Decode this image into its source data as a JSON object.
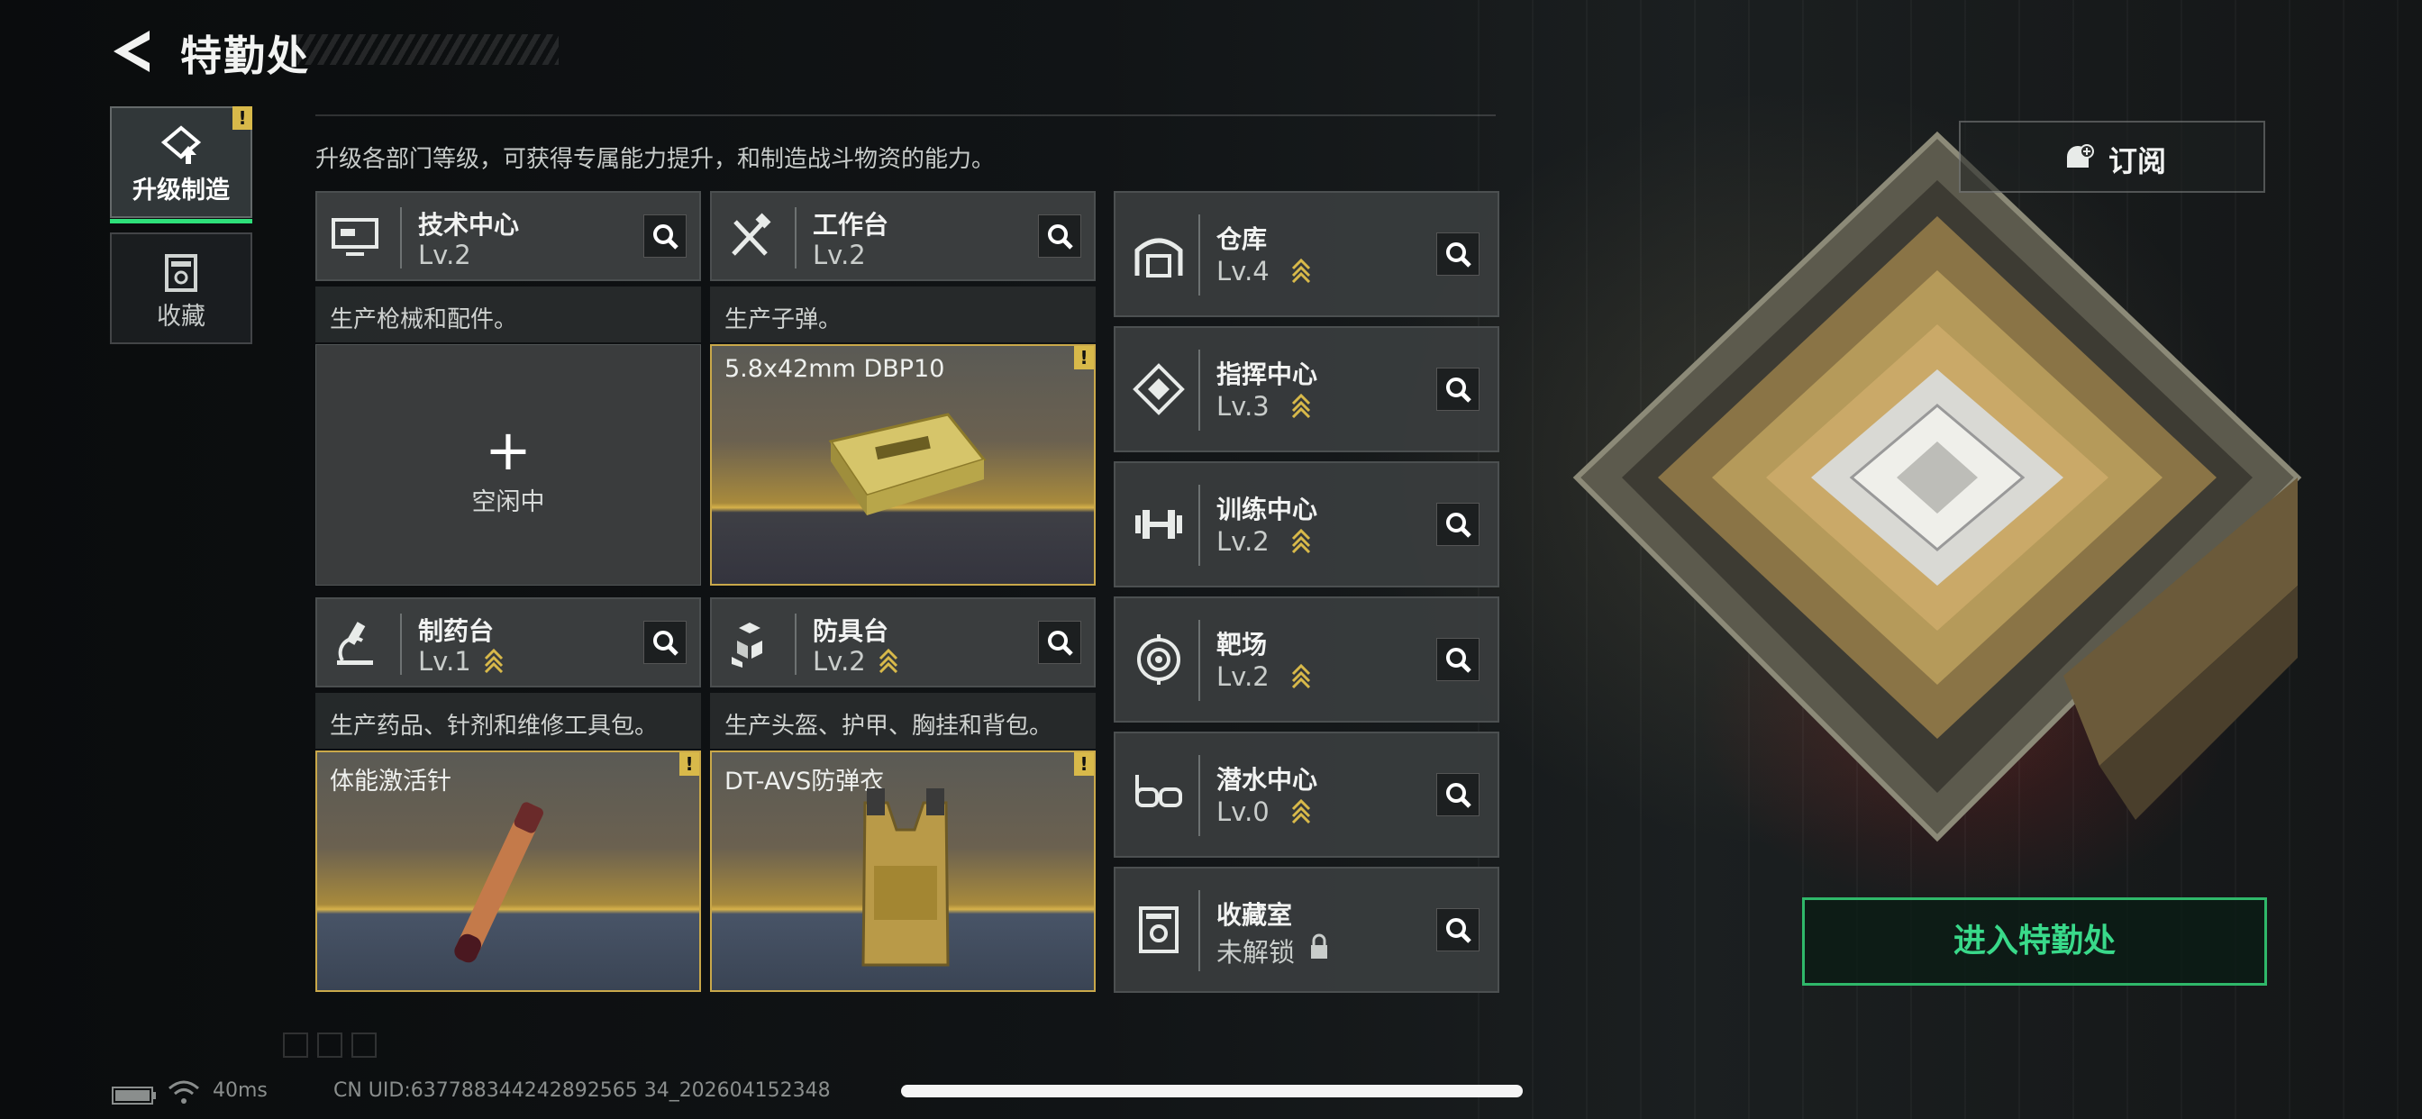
{
  "header": {
    "title": "特勤处",
    "description": "升级各部门等级，可获得专属能力提升，和制造战斗物资的能力。"
  },
  "sidebar": {
    "tabs": [
      {
        "label": "升级制造"
      },
      {
        "label": "收藏"
      }
    ]
  },
  "workshops": [
    {
      "name": "技术中心",
      "level": "Lv.2",
      "desc": "生产枪械和配件。",
      "slot": {
        "state": "idle",
        "idle_label": "空闲中"
      }
    },
    {
      "name": "工作台",
      "level": "Lv.2",
      "desc": "生产子弹。",
      "slot": {
        "state": "active",
        "item": "5.8x42mm DBP10"
      }
    },
    {
      "name": "制药台",
      "level": "Lv.1",
      "desc": "生产药品、针剂和维修工具包。",
      "slot": {
        "state": "active",
        "item": "体能激活针"
      }
    },
    {
      "name": "防具台",
      "level": "Lv.2",
      "desc": "生产头盔、护甲、胸挂和背包。",
      "slot": {
        "state": "active",
        "item": "DT-AVS防弹衣"
      }
    }
  ],
  "facilities": [
    {
      "name": "仓库",
      "level": "Lv.4"
    },
    {
      "name": "指挥中心",
      "level": "Lv.3"
    },
    {
      "name": "训练中心",
      "level": "Lv.2"
    },
    {
      "name": "靶场",
      "level": "Lv.2"
    },
    {
      "name": "潜水中心",
      "level": "Lv.0"
    },
    {
      "name": "收藏室",
      "level": "未解锁"
    }
  ],
  "actions": {
    "subscribe": "订阅",
    "enter": "进入特勤处"
  },
  "status": {
    "ping": "40ms",
    "uid": "CN UID:637788344242892565 34_202604152348"
  },
  "colors": {
    "accent_green": "#2fb86a",
    "gold": "#c9a84a",
    "warn": "#d8b94a"
  }
}
